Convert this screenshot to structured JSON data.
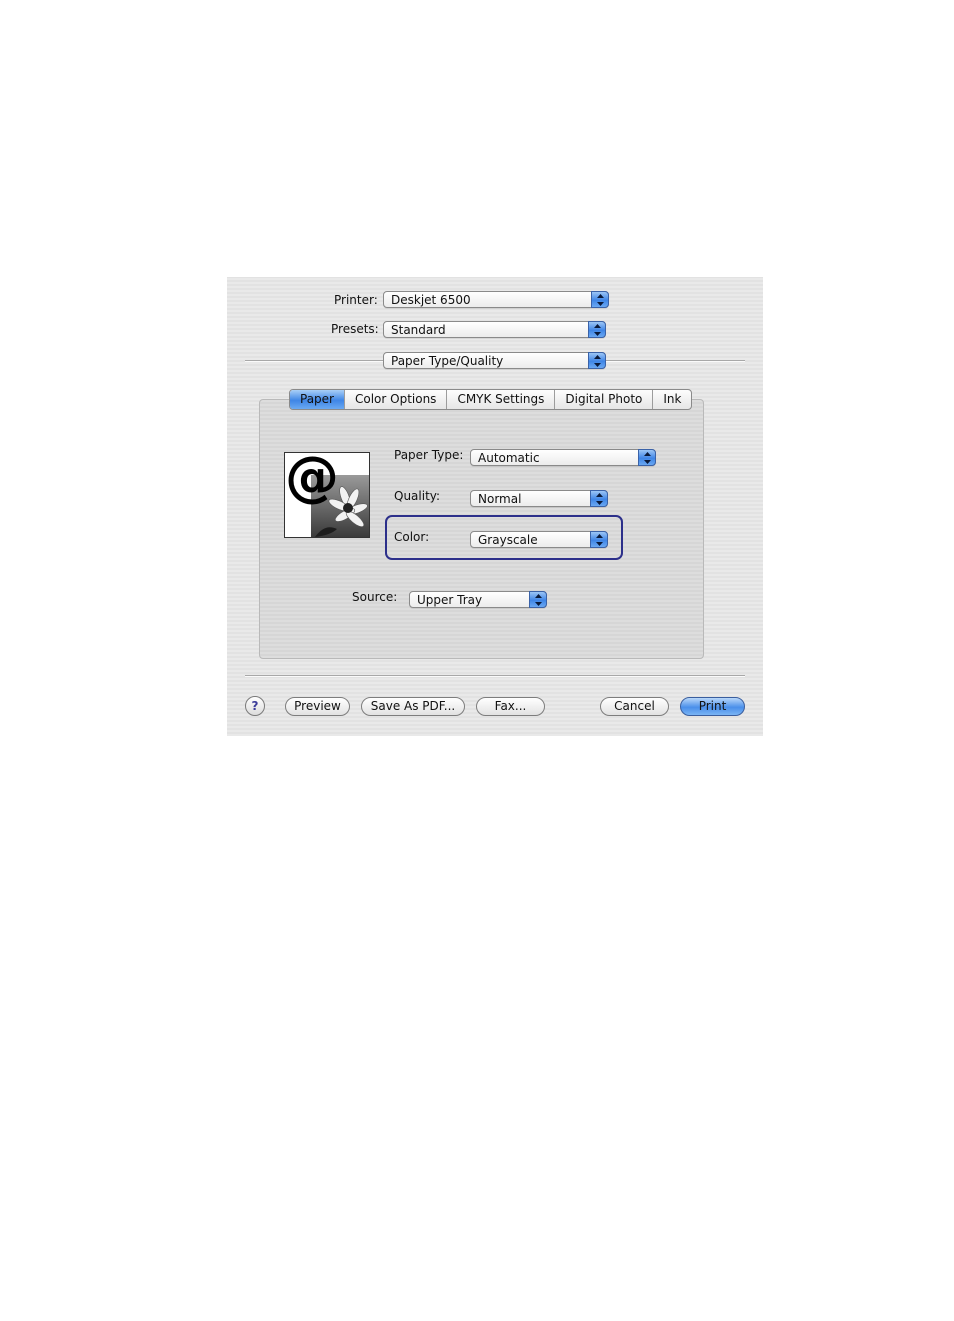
{
  "printer": {
    "label": "Printer:",
    "value": "Deskjet 6500"
  },
  "presets": {
    "label": "Presets:",
    "value": "Standard"
  },
  "pane_menu": {
    "value": "Paper Type/Quality"
  },
  "tabs": [
    {
      "label": "Paper",
      "selected": true
    },
    {
      "label": "Color Options",
      "selected": false
    },
    {
      "label": "CMYK Settings",
      "selected": false
    },
    {
      "label": "Digital Photo",
      "selected": false
    },
    {
      "label": "Ink",
      "selected": false
    }
  ],
  "paper_type": {
    "label": "Paper Type:",
    "value": "Automatic"
  },
  "quality": {
    "label": "Quality:",
    "value": "Normal"
  },
  "color": {
    "label": "Color:",
    "value": "Grayscale"
  },
  "source": {
    "label": "Source:",
    "value": "Upper Tray"
  },
  "buttons": {
    "help": "?",
    "preview": "Preview",
    "save_pdf": "Save As PDF...",
    "fax": "Fax...",
    "cancel": "Cancel",
    "print": "Print"
  },
  "preview_icon": {
    "glyph": "@",
    "icon": "paper-preview-icon"
  },
  "colors": {
    "accent": "#3f85e6",
    "highlight_border": "#2c2f8a"
  }
}
